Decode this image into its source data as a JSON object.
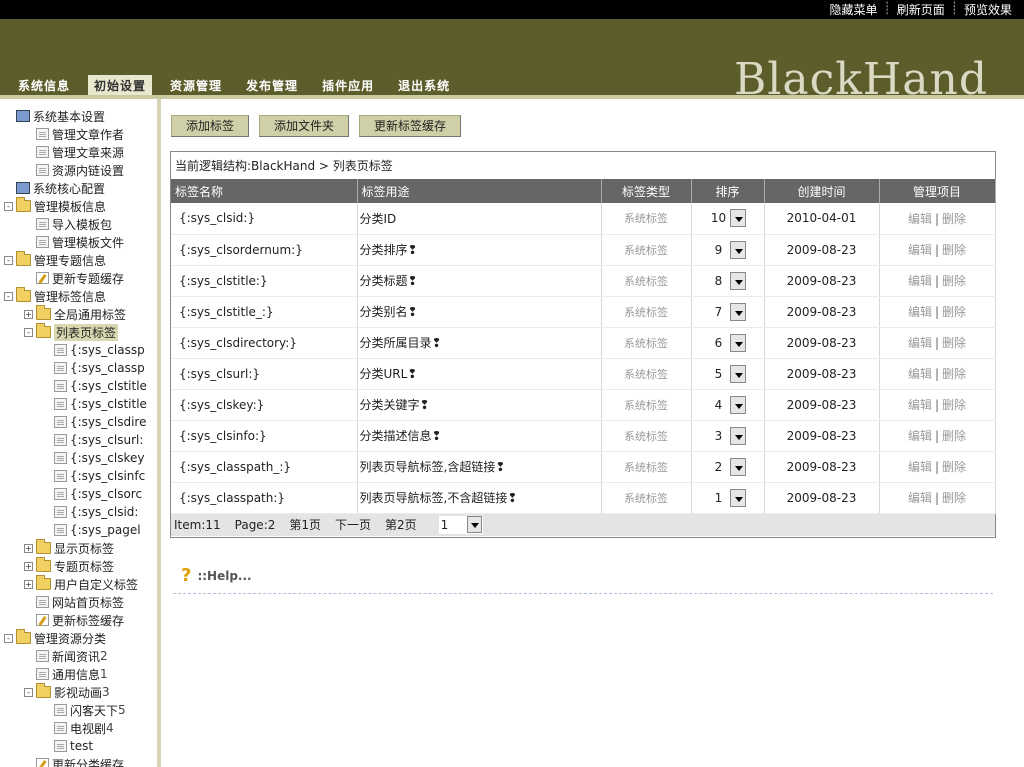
{
  "topbar": {
    "links": [
      "隐藏菜单",
      "刷新页面",
      "预览效果"
    ]
  },
  "header": {
    "logo": "BlackHand",
    "nav": [
      {
        "label": "系统信息",
        "active": false
      },
      {
        "label": "初始设置",
        "active": true
      },
      {
        "label": "资源管理",
        "active": false
      },
      {
        "label": "发布管理",
        "active": false
      },
      {
        "label": "插件应用",
        "active": false
      },
      {
        "label": "退出系统",
        "active": false
      }
    ]
  },
  "tree": [
    {
      "indent": 0,
      "toggle": "",
      "icon": "computer",
      "label": "系统基本设置"
    },
    {
      "indent": 1,
      "toggle": "",
      "icon": "page",
      "label": "管理文章作者"
    },
    {
      "indent": 1,
      "toggle": "",
      "icon": "page",
      "label": "管理文章来源"
    },
    {
      "indent": 1,
      "toggle": "",
      "icon": "page",
      "label": "资源内链设置"
    },
    {
      "indent": 0,
      "toggle": "",
      "icon": "computer",
      "label": "系统核心配置"
    },
    {
      "indent": 0,
      "toggle": "-",
      "icon": "folder",
      "label": "管理模板信息"
    },
    {
      "indent": 1,
      "toggle": "",
      "icon": "page",
      "label": "导入模板包"
    },
    {
      "indent": 1,
      "toggle": "",
      "icon": "page",
      "label": "管理模板文件"
    },
    {
      "indent": 0,
      "toggle": "-",
      "icon": "folder",
      "label": "管理专题信息"
    },
    {
      "indent": 1,
      "toggle": "",
      "icon": "edit",
      "label": "更新专题缓存"
    },
    {
      "indent": 0,
      "toggle": "-",
      "icon": "folder",
      "label": "管理标签信息"
    },
    {
      "indent": 1,
      "toggle": "+",
      "icon": "folder",
      "label": "全局通用标签"
    },
    {
      "indent": 1,
      "toggle": "-",
      "icon": "folder",
      "label": "列表页标签",
      "selected": true
    },
    {
      "indent": 2,
      "toggle": "",
      "icon": "page",
      "label": "{:sys_classp"
    },
    {
      "indent": 2,
      "toggle": "",
      "icon": "page",
      "label": "{:sys_classp"
    },
    {
      "indent": 2,
      "toggle": "",
      "icon": "page",
      "label": "{:sys_clstitle"
    },
    {
      "indent": 2,
      "toggle": "",
      "icon": "page",
      "label": "{:sys_clstitle"
    },
    {
      "indent": 2,
      "toggle": "",
      "icon": "page",
      "label": "{:sys_clsdire"
    },
    {
      "indent": 2,
      "toggle": "",
      "icon": "page",
      "label": "{:sys_clsurl:"
    },
    {
      "indent": 2,
      "toggle": "",
      "icon": "page",
      "label": "{:sys_clskey"
    },
    {
      "indent": 2,
      "toggle": "",
      "icon": "page",
      "label": "{:sys_clsinfc"
    },
    {
      "indent": 2,
      "toggle": "",
      "icon": "page",
      "label": "{:sys_clsorc"
    },
    {
      "indent": 2,
      "toggle": "",
      "icon": "page",
      "label": "{:sys_clsid:"
    },
    {
      "indent": 2,
      "toggle": "",
      "icon": "page",
      "label": "{:sys_pagel"
    },
    {
      "indent": 1,
      "toggle": "+",
      "icon": "folder",
      "label": "显示页标签"
    },
    {
      "indent": 1,
      "toggle": "+",
      "icon": "folder",
      "label": "专题页标签"
    },
    {
      "indent": 1,
      "toggle": "+",
      "icon": "folder",
      "label": "用户自定义标签"
    },
    {
      "indent": 1,
      "toggle": "",
      "icon": "page",
      "label": "网站首页标签"
    },
    {
      "indent": 1,
      "toggle": "",
      "icon": "edit",
      "label": "更新标签缓存"
    },
    {
      "indent": 0,
      "toggle": "-",
      "icon": "folder",
      "label": "管理资源分类"
    },
    {
      "indent": 1,
      "toggle": "",
      "icon": "page",
      "label": "新闻资讯",
      "count": "2"
    },
    {
      "indent": 1,
      "toggle": "",
      "icon": "page",
      "label": "通用信息",
      "count": "1"
    },
    {
      "indent": 1,
      "toggle": "-",
      "icon": "folder",
      "label": "影视动画",
      "count": "3"
    },
    {
      "indent": 2,
      "toggle": "",
      "icon": "page",
      "label": "闪客天下",
      "count": "5"
    },
    {
      "indent": 2,
      "toggle": "",
      "icon": "page",
      "label": "电视剧",
      "count": "4"
    },
    {
      "indent": 2,
      "toggle": "",
      "icon": "page",
      "label": "test"
    },
    {
      "indent": 1,
      "toggle": "",
      "icon": "edit",
      "label": "更新分类缓存"
    }
  ],
  "buttons": {
    "add_tag": "添加标签",
    "add_folder": "添加文件夹",
    "update_cache": "更新标签缓存"
  },
  "breadcrumb": "当前逻辑结构:BlackHand > 列表页标签",
  "table": {
    "headers": {
      "name": "标签名称",
      "use": "标签用途",
      "type": "标签类型",
      "sort": "排序",
      "created": "创建时间",
      "manage": "管理项目"
    },
    "rows": [
      {
        "name": "{:sys_clsid:}",
        "use": "分类ID",
        "type": "系统标签",
        "sort": "10",
        "created": "2010-04-01"
      },
      {
        "name": "{:sys_clsordernum:}",
        "use": "分类排序❢",
        "type": "系统标签",
        "sort": "9",
        "created": "2009-08-23"
      },
      {
        "name": "{:sys_clstitle:}",
        "use": "分类标题❢",
        "type": "系统标签",
        "sort": "8",
        "created": "2009-08-23"
      },
      {
        "name": "{:sys_clstitle_:}",
        "use": "分类别名❢",
        "type": "系统标签",
        "sort": "7",
        "created": "2009-08-23"
      },
      {
        "name": "{:sys_clsdirectory:}",
        "use": "分类所属目录❢",
        "type": "系统标签",
        "sort": "6",
        "created": "2009-08-23"
      },
      {
        "name": "{:sys_clsurl:}",
        "use": "分类URL❢",
        "type": "系统标签",
        "sort": "5",
        "created": "2009-08-23"
      },
      {
        "name": "{:sys_clskey:}",
        "use": "分类关键字❢",
        "type": "系统标签",
        "sort": "4",
        "created": "2009-08-23"
      },
      {
        "name": "{:sys_clsinfo:}",
        "use": "分类描述信息❢",
        "type": "系统标签",
        "sort": "3",
        "created": "2009-08-23"
      },
      {
        "name": "{:sys_classpath_:}",
        "use": "列表页导航标签,含超链接❢",
        "type": "系统标签",
        "sort": "2",
        "created": "2009-08-23"
      },
      {
        "name": "{:sys_classpath:}",
        "use": "列表页导航标签,不含超链接❢",
        "type": "系统标签",
        "sort": "1",
        "created": "2009-08-23"
      }
    ],
    "edit_label": "编辑",
    "delete_label": "删除"
  },
  "pager": {
    "items": "Item:11",
    "page": "Page:2",
    "first": "第1页",
    "next": "下一页",
    "last": "第2页",
    "current": "1"
  },
  "help": {
    "label": "::Help..."
  }
}
